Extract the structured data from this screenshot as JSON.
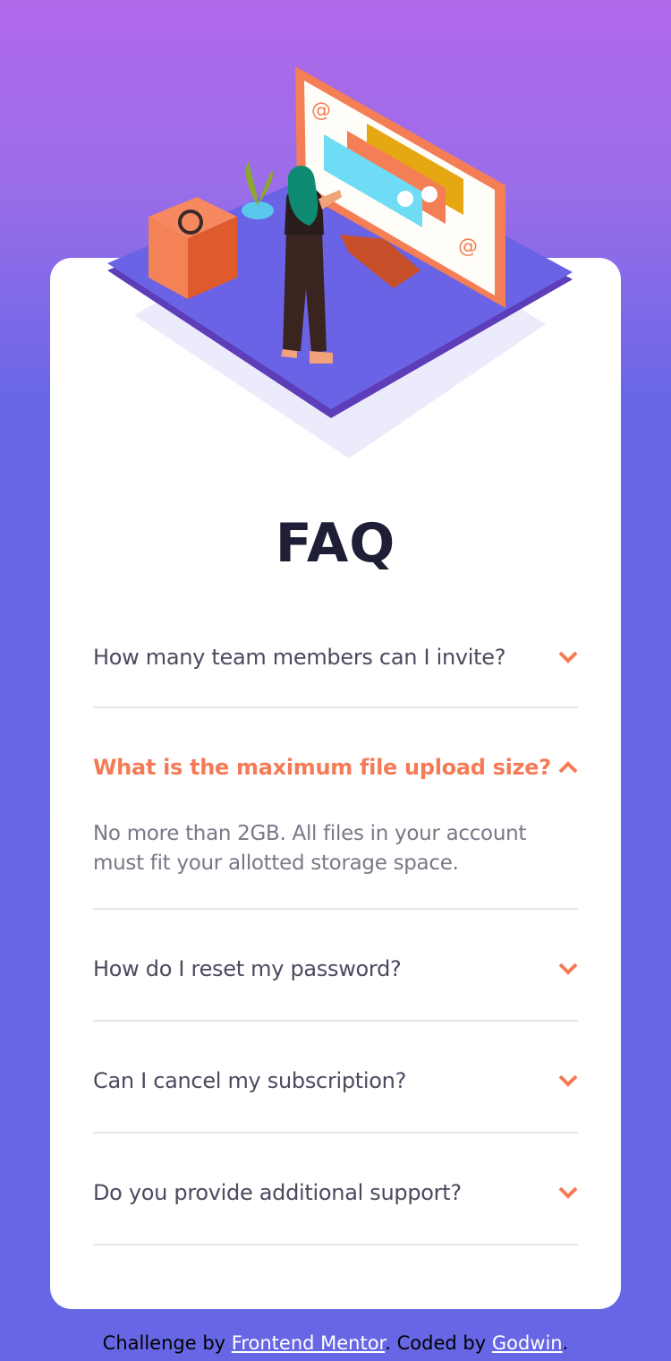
{
  "page": {
    "title": "FAQ"
  },
  "faq": [
    {
      "question": "How many team members can I invite?",
      "answer": "",
      "open": false
    },
    {
      "question": "What is the maximum file upload size?",
      "answer": "No more than 2GB. All files in your account must fit your allotted storage space.",
      "open": true
    },
    {
      "question": "How do I reset my password?",
      "answer": "",
      "open": false
    },
    {
      "question": "Can I cancel my subscription?",
      "answer": "",
      "open": false
    },
    {
      "question": "Do you provide additional support?",
      "answer": "",
      "open": false
    }
  ],
  "footer": {
    "prefix": "Challenge by ",
    "link1": "Frontend Mentor",
    "middle": ". Coded by ",
    "link2": "Godwin",
    "suffix": "."
  },
  "colors": {
    "accent": "#f47b56",
    "heading": "#1e1f36",
    "text": "#4a4b5e",
    "answer": "#787887",
    "bg_top": "#b068e9",
    "bg_bottom": "#6767e6"
  },
  "icons": {
    "collapsed": "chevron-down-icon",
    "expanded": "chevron-up-icon"
  }
}
